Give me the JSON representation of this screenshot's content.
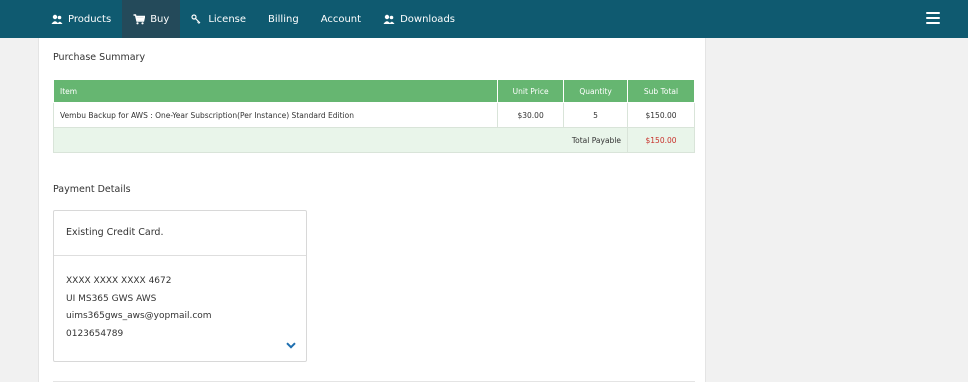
{
  "nav": {
    "items": [
      {
        "label": "Products",
        "icon": "people-icon"
      },
      {
        "label": "Buy",
        "icon": "cart-icon",
        "active": true
      },
      {
        "label": "License",
        "icon": "key-icon"
      },
      {
        "label": "Billing"
      },
      {
        "label": "Account"
      },
      {
        "label": "Downloads",
        "icon": "people-icon"
      }
    ],
    "menu_icon": "hamburger-menu-icon"
  },
  "purchase_summary": {
    "title": "Purchase Summary",
    "columns": [
      "Item",
      "Unit Price",
      "Quantity",
      "Sub Total"
    ],
    "rows": [
      {
        "item": "Vembu Backup for AWS : One-Year Subscription(Per Instance) Standard Edition",
        "unit_price": "$30.00",
        "quantity": "5",
        "sub_total": "$150.00"
      }
    ],
    "total_label": "Total Payable",
    "total_value": "$150.00"
  },
  "payment": {
    "title": "Payment Details",
    "card_title": "Existing Credit Card.",
    "card_number": "XXXX XXXX XXXX 4672",
    "name": "UI MS365 GWS AWS",
    "email": "uims365gws_aws@yopmail.com",
    "phone": "0123654789"
  },
  "colors": {
    "navbar": "#0f5a70",
    "table_header": "#66b671",
    "total_row": "#e9f5ea",
    "total_value": "#c8322c",
    "chevron": "#1e6fb0"
  }
}
